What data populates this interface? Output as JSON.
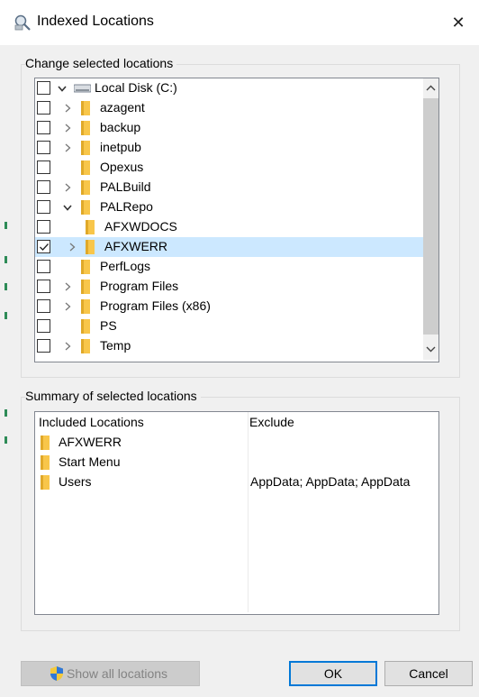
{
  "window": {
    "title": "Indexed Locations",
    "close_glyph": "✕"
  },
  "change_group": {
    "legend": "Change selected locations",
    "rows": [
      {
        "label": "Local Disk (C:)",
        "checked": false,
        "expander": "expanded",
        "icon": "drive-icon",
        "indent": 0
      },
      {
        "label": "azagent",
        "checked": false,
        "expander": "collapsed",
        "icon": "folder-icon",
        "indent": 1
      },
      {
        "label": "backup",
        "checked": false,
        "expander": "collapsed",
        "icon": "folder-icon",
        "indent": 1
      },
      {
        "label": "inetpub",
        "checked": false,
        "expander": "collapsed",
        "icon": "folder-icon",
        "indent": 1
      },
      {
        "label": "Opexus",
        "checked": false,
        "expander": "none",
        "icon": "folder-icon",
        "indent": 1
      },
      {
        "label": "PALBuild",
        "checked": false,
        "expander": "collapsed",
        "icon": "folder-icon",
        "indent": 1
      },
      {
        "label": "PALRepo",
        "checked": false,
        "expander": "expanded",
        "icon": "folder-icon",
        "indent": 1
      },
      {
        "label": "AFXWDOCS",
        "checked": false,
        "expander": "none",
        "icon": "folder-icon",
        "indent": 2
      },
      {
        "label": "AFXWERR",
        "checked": true,
        "expander": "collapsed",
        "icon": "folder-icon",
        "indent": 2,
        "selected": true
      },
      {
        "label": "PerfLogs",
        "checked": false,
        "expander": "none",
        "icon": "folder-icon",
        "indent": 1
      },
      {
        "label": "Program Files",
        "checked": false,
        "expander": "collapsed",
        "icon": "folder-icon",
        "indent": 1
      },
      {
        "label": "Program Files (x86)",
        "checked": false,
        "expander": "collapsed",
        "icon": "folder-icon",
        "indent": 1
      },
      {
        "label": "PS",
        "checked": false,
        "expander": "none",
        "icon": "folder-icon",
        "indent": 1
      },
      {
        "label": "Temp",
        "checked": false,
        "expander": "collapsed",
        "icon": "folder-icon",
        "indent": 1
      }
    ]
  },
  "summary_group": {
    "legend": "Summary of selected locations",
    "col_included": "Included Locations",
    "col_exclude": "Exclude",
    "rows": [
      {
        "included": "AFXWERR",
        "exclude": ""
      },
      {
        "included": "Start Menu",
        "exclude": ""
      },
      {
        "included": "Users",
        "exclude": "AppData; AppData; AppData"
      }
    ]
  },
  "buttons": {
    "show_all": "Show all locations",
    "ok": "OK",
    "cancel": "Cancel"
  },
  "colors": {
    "selection": "#cce8ff",
    "folder": "#f8c64a",
    "accent": "#0078d7"
  }
}
